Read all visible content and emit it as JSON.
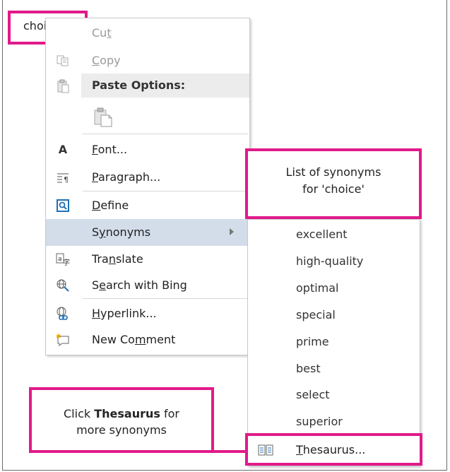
{
  "selected_word": "choice",
  "menu": {
    "cut": "Cut",
    "copy": "Copy",
    "paste_options": "Paste Options:",
    "font": "Font...",
    "paragraph": "Paragraph...",
    "define": "Define",
    "synonyms": "Synonyms",
    "translate": "Translate",
    "search_with_bing": "Search with Bing",
    "hyperlink": "Hyperlink...",
    "new_comment": "New Comment"
  },
  "synonyms": [
    "excellent",
    "high-quality",
    "optimal",
    "special",
    "prime",
    "best",
    "select",
    "superior"
  ],
  "thesaurus": "Thesaurus...",
  "callouts": {
    "synonyms_line1": "List of synonyms",
    "synonyms_line2": "for 'choice'",
    "thesaurus_pre": "Click ",
    "thesaurus_bold": "Thesaurus",
    "thesaurus_post": " for",
    "thesaurus_line2": "more synonyms"
  },
  "colors": {
    "callout_border": "#e11a8a",
    "highlight": "#d3dde9"
  }
}
